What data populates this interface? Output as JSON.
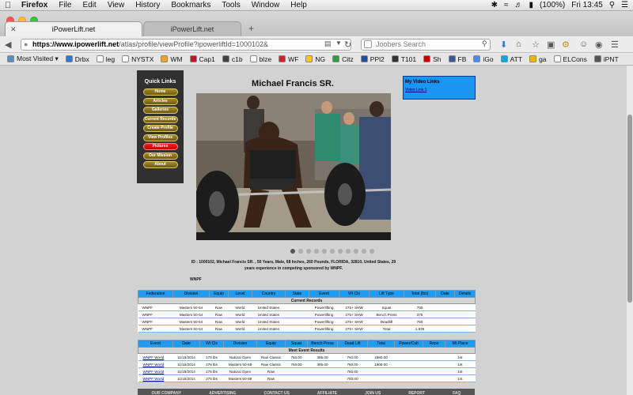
{
  "menubar": {
    "app": "Firefox",
    "items": [
      "File",
      "Edit",
      "View",
      "History",
      "Bookmarks",
      "Tools",
      "Window",
      "Help"
    ],
    "battery": "(100%)",
    "clock": "Fri 13:45"
  },
  "tabs": [
    {
      "title": "iPowerLift.net",
      "active": true
    },
    {
      "title": "iPowerLift.net",
      "active": false
    }
  ],
  "url": {
    "domain": "https://www.ipowerlift.net",
    "path": "/atlas/profile/viewProfile?ipowerliftId=1000102&"
  },
  "search": {
    "placeholder": "Joobers Search"
  },
  "bookmarks": [
    {
      "label": "Most Visited ▾",
      "color": "#5b8ec9"
    },
    {
      "label": "Drbx",
      "color": "#2c78d8"
    },
    {
      "label": "leg",
      "color": "#ffffff"
    },
    {
      "label": "NYSTX",
      "color": "#ffffff"
    },
    {
      "label": "WM",
      "color": "#f0a030"
    },
    {
      "label": "Cap1",
      "color": "#c8102e"
    },
    {
      "label": "c1b",
      "color": "#444444"
    },
    {
      "label": "blze",
      "color": "#ffffff"
    },
    {
      "label": "WF",
      "color": "#d71e28"
    },
    {
      "label": "NG",
      "color": "#ffcc00"
    },
    {
      "label": "Citz",
      "color": "#2f9e44"
    },
    {
      "label": "PPl2",
      "color": "#1f4fa0"
    },
    {
      "label": "T101",
      "color": "#333333"
    },
    {
      "label": "Sh",
      "color": "#c70000"
    },
    {
      "label": "FB",
      "color": "#3b5998"
    },
    {
      "label": "iGo",
      "color": "#4a8af4"
    },
    {
      "label": "ATT",
      "color": "#00a8e0"
    },
    {
      "label": "ga",
      "color": "#f4b400"
    },
    {
      "label": "ELCons",
      "color": "#ffffff"
    },
    {
      "label": "iPNT",
      "color": "#555555"
    }
  ],
  "quick_links": {
    "title": "Quick Links",
    "items": [
      {
        "label": "Home",
        "highlight": false
      },
      {
        "label": "Articles",
        "highlight": false
      },
      {
        "label": "Galleries",
        "highlight": false
      },
      {
        "label": "Current Records",
        "highlight": false
      },
      {
        "label": "Create Profile",
        "highlight": false
      },
      {
        "label": "View Profiles",
        "highlight": false
      },
      {
        "label": "Pictures",
        "highlight": true
      },
      {
        "label": "Our Mission",
        "highlight": false
      },
      {
        "label": "About",
        "highlight": false
      }
    ]
  },
  "profile": {
    "name": "Michael Francis SR.",
    "bio": "ID : 1000102, Michael Francis SR. , 50 Years, Male, 68 Inches, 260 Pounds, FLORIDA, 32810, United States, 29 years experience in competing sponsored by WNPF.",
    "org": "WNPF"
  },
  "slider": {
    "count": 11,
    "active": 0
  },
  "video_links": {
    "title": "My Video Links",
    "link": "Video Link 1"
  },
  "records": {
    "headers": [
      "Federation",
      "Division",
      "Equip",
      "Level",
      "Country",
      "State",
      "Event",
      "Wt Cls",
      "Lift Type",
      "Total (lbs)",
      "Date",
      "Details"
    ],
    "section": "Current Records",
    "rows": [
      [
        "WNPF",
        "Masters 50-54",
        "Raw",
        "World",
        "United States",
        "",
        "Powerlifting",
        "275+ SHW",
        "Squat",
        "700",
        "",
        ""
      ],
      [
        "WNPF",
        "Masters 50-54",
        "Raw",
        "World",
        "United States",
        "",
        "Powerlifting",
        "275+ SHW",
        "Bench Press",
        "375",
        "",
        ""
      ],
      [
        "WNPF",
        "Masters 50-54",
        "Raw",
        "World",
        "United States",
        "",
        "Powerlifting",
        "275+ SHW",
        "Deadlift",
        "760",
        "",
        ""
      ],
      [
        "WNPF",
        "Masters 50-54",
        "Raw",
        "World",
        "United States",
        "",
        "Powerlifting",
        "275+ SHW",
        "Total",
        "1,835",
        "",
        ""
      ]
    ]
  },
  "meets": {
    "headers": [
      "Event",
      "Date",
      "Wt Cls",
      "Division",
      "Equip",
      "Squat",
      "Bench Press",
      "Dead Lift",
      "Total",
      "Power/Cult",
      "Reps",
      "Wt Place"
    ],
    "section": "Meet Event Results",
    "rows": [
      [
        "WNPF World",
        "11/15/2014",
        "275 lbs",
        "Natural Open",
        "Raw Classic",
        "760.00",
        "395.00",
        "760.00",
        "1980.00",
        "",
        "",
        "1st"
      ],
      [
        "WNPF World",
        "11/15/2014",
        "275 lbs",
        "Masters 50-59",
        "Raw Classic",
        "760.00",
        "395.00",
        "760.00",
        "1908.00",
        "",
        "",
        "1st"
      ],
      [
        "WNPF World",
        "11/15/2014",
        "275 lbs",
        "Natural Open",
        "Raw",
        "",
        "",
        "760.00",
        "",
        "",
        "",
        "1st"
      ],
      [
        "WNPF World",
        "11/15/2014",
        "275 lbs",
        "Masters 50-59",
        "Raw",
        "",
        "",
        "760.00",
        "",
        "",
        "",
        "1st"
      ]
    ]
  },
  "footer": {
    "items": [
      "OUR COMPANY",
      "ADVERTISING",
      "CONTACT US",
      "AFFILIATE",
      "JOIN US",
      "REPORT",
      "FAQ"
    ]
  }
}
